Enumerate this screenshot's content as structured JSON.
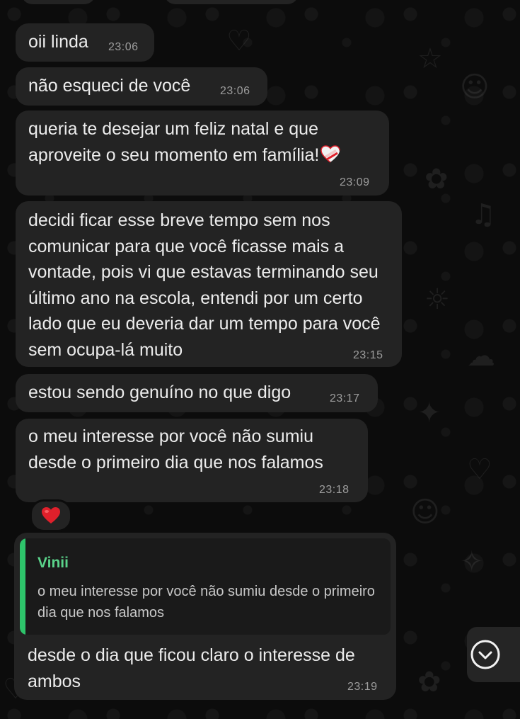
{
  "messages": [
    {
      "text": "oii linda",
      "time": "23:06"
    },
    {
      "text": "não esqueci de você",
      "time": "23:06"
    },
    {
      "text": "queria te desejar um feliz natal e que aproveite o seu momento em família!",
      "emoji": "heart-with-bandage",
      "time": "23:09"
    },
    {
      "text": "decidi ficar esse breve tempo sem nos comunicar para que você ficasse mais a vontade, pois vi que estavas terminando seu último ano na escola, entendi por um certo lado que eu deveria dar um tempo para você sem ocupa-lá muito",
      "time": "23:15"
    },
    {
      "text": "estou sendo genuíno no que digo",
      "time": "23:17"
    },
    {
      "text": "o meu interesse por você não sumiu desde o primeiro dia que nos falamos",
      "time": "23:18",
      "reaction": "red-heart"
    },
    {
      "reply_to": {
        "author": "Vinii",
        "text": "o meu interesse por você não sumiu desde o primeiro dia que nos falamos"
      },
      "text": "desde o dia que ficou claro o interesse de ambos",
      "time": "23:19"
    }
  ],
  "icons": {
    "scroll_down": "chevron-down-circle-icon",
    "reaction": "red-heart-icon",
    "message_emoji": "mending-heart-icon"
  },
  "colors": {
    "bubble": "#232323",
    "background": "#0c0c0c",
    "quote_accent": "#2ec46b",
    "quote_author": "#5ad38a",
    "timestamp": "#9d9d9d",
    "heart": "#e0202b"
  }
}
